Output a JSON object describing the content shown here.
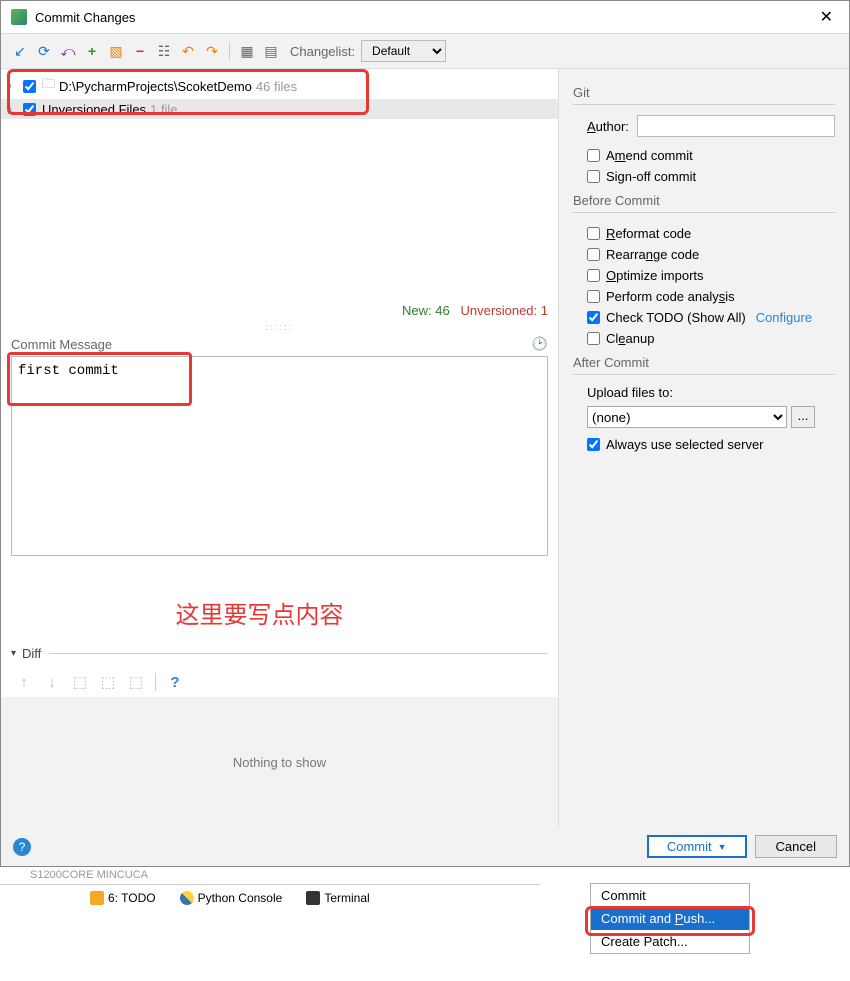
{
  "titlebar": {
    "title": "Commit Changes"
  },
  "toolbar": {
    "changelist_label": "Changelist:",
    "changelist_value": "Default"
  },
  "tree": {
    "row1_path": "D:\\PycharmProjects\\ScoketDemo",
    "row1_count": "46 files",
    "row2_label": "Unversioned Files",
    "row2_count": "1 file"
  },
  "status": {
    "new_label": "New: 46",
    "unv_label": "Unversioned: 1"
  },
  "commit_message": {
    "label": "Commit Message",
    "text": "first commit",
    "annotation": "这里要写点内容"
  },
  "diff": {
    "label": "Diff",
    "nothing": "Nothing to show"
  },
  "right": {
    "git": "Git",
    "author_label": "Author:",
    "amend": "Amend commit",
    "signoff": "Sign-off commit",
    "before": "Before Commit",
    "reformat": "Reformat code",
    "rearrange": "Rearrange code",
    "optimize": "Optimize imports",
    "analysis": "Perform code analysis",
    "todo": "Check TODO (Show All)",
    "configure": "Configure",
    "cleanup": "Cleanup",
    "after": "After Commit",
    "upload": "Upload files to:",
    "upload_value": "(none)",
    "always": "Always use selected server"
  },
  "buttons": {
    "commit": "Commit",
    "cancel": "Cancel",
    "dd_commit": "Commit",
    "dd_push": "Commit and Push...",
    "dd_patch": "Create Patch..."
  },
  "tabs": {
    "todo": "6: TODO",
    "python": "Python Console",
    "terminal": "Terminal"
  },
  "blur": "S1200CORE MINCUCA"
}
